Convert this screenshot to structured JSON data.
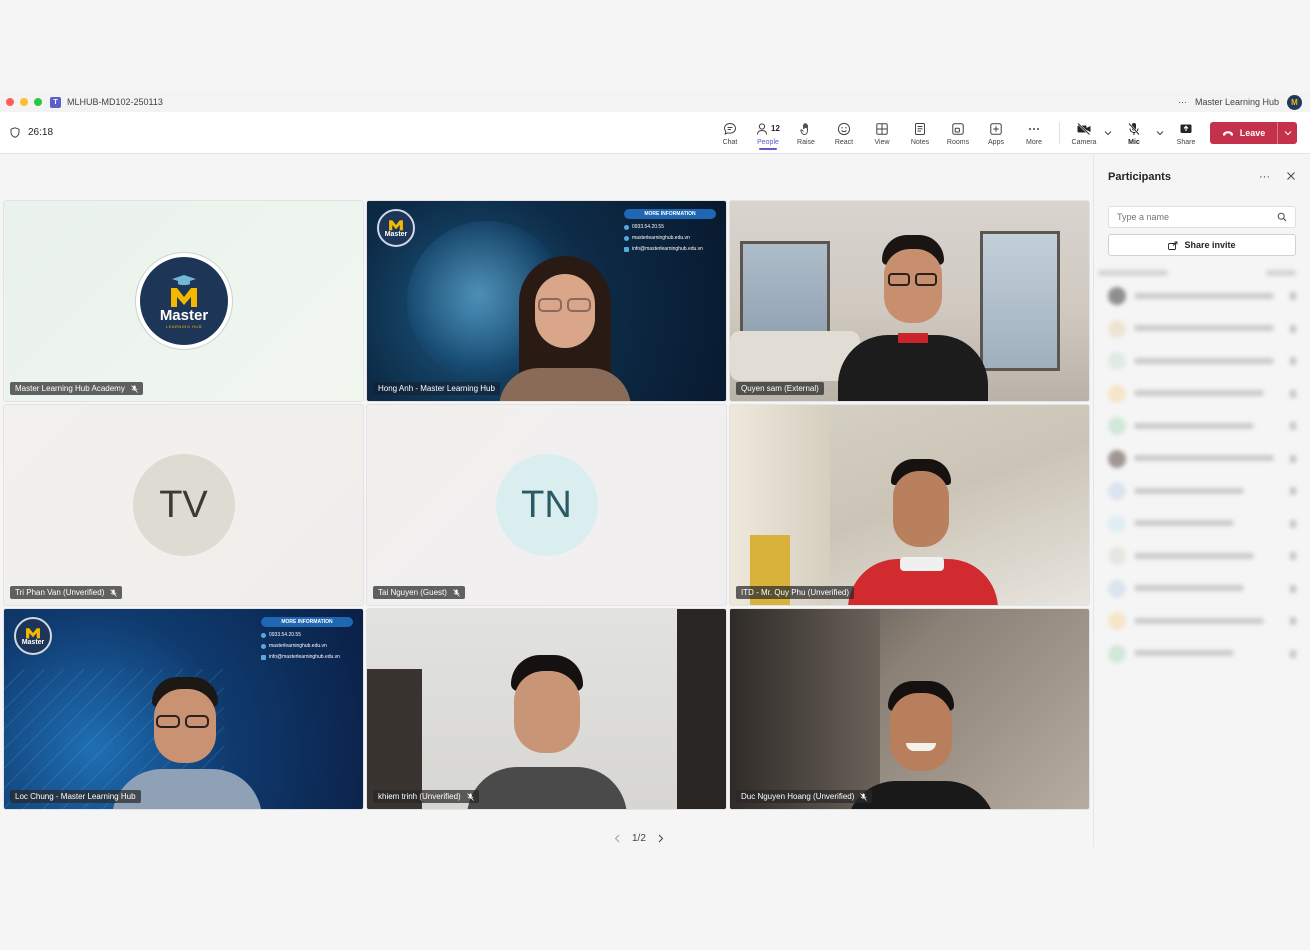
{
  "titlebar": {
    "meeting_code": "MLHUB-MD102-250113",
    "more": "···",
    "org_name": "Master Learning Hub",
    "org_initial": "M"
  },
  "toolbar": {
    "timer": "26:18",
    "items": [
      {
        "label": "Chat",
        "icon": "chat-icon"
      },
      {
        "label": "People",
        "icon": "people-icon",
        "count": "12"
      },
      {
        "label": "Raise",
        "icon": "raise-hand-icon"
      },
      {
        "label": "React",
        "icon": "react-icon"
      },
      {
        "label": "View",
        "icon": "view-icon"
      },
      {
        "label": "Notes",
        "icon": "notes-icon"
      },
      {
        "label": "Rooms",
        "icon": "rooms-icon"
      },
      {
        "label": "Apps",
        "icon": "apps-icon"
      },
      {
        "label": "More",
        "icon": "more-icon"
      }
    ],
    "camera_label": "Camera",
    "mic_label": "Mic",
    "share_label": "Share",
    "leave_label": "Leave"
  },
  "tiles": [
    {
      "name": "Master Learning Hub Academy",
      "muted": true,
      "kind": "logo"
    },
    {
      "name": "Hong Anh - Master Learning Hub",
      "muted": false,
      "kind": "video"
    },
    {
      "name": "Quyen sam (External)",
      "muted": false,
      "kind": "video"
    },
    {
      "name": "Tri Phan Van (Unverified)",
      "muted": true,
      "kind": "initials",
      "initials": "TV"
    },
    {
      "name": "Tai Nguyen (Guest)",
      "muted": true,
      "kind": "initials",
      "initials": "TN"
    },
    {
      "name": "ITD - Mr. Quy Phu (Unverified)",
      "muted": false,
      "kind": "video"
    },
    {
      "name": "Loc Chung - Master Learning Hub",
      "muted": false,
      "kind": "video"
    },
    {
      "name": "khiem trinh (Unverified)",
      "muted": true,
      "kind": "video"
    },
    {
      "name": "Duc Nguyen Hoang (Unverified)",
      "muted": true,
      "kind": "video"
    }
  ],
  "logo": {
    "brand": "Master",
    "tagline": "LEARNING HUB"
  },
  "background": {
    "heading": "MORE INFORMATION",
    "phone": "0933.54.20.55",
    "website": "masterlearninghub.edu.vn",
    "email": "info@masterlearninghub.edu.vn"
  },
  "pager": {
    "label": "1/2"
  },
  "panel": {
    "title": "Participants",
    "search_placeholder": "Type a name",
    "invite_label": "Share invite"
  },
  "colors": {
    "accent": "#5b5fc7",
    "leave": "#c4314b"
  }
}
